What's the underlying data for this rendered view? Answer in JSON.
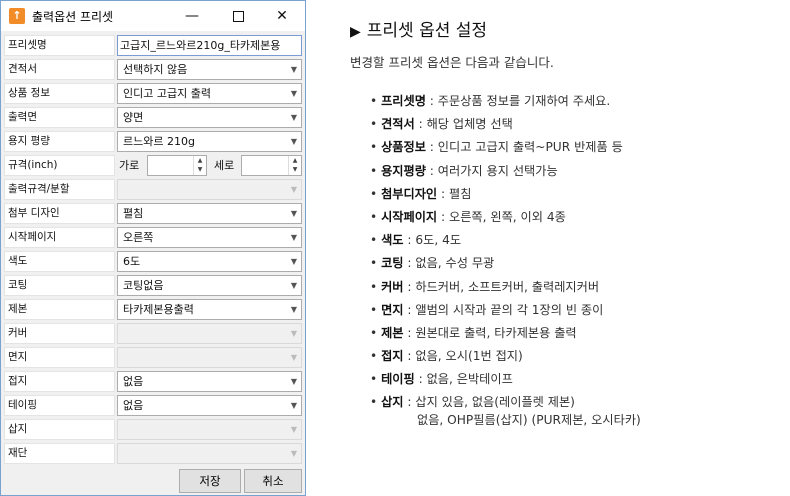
{
  "dialog": {
    "title": "출력옵션 프리셋",
    "rows": [
      {
        "label": "프리셋명",
        "value": "고급지_르느와르210g_타카제본용"
      },
      {
        "label": "견적서",
        "value": "선택하지 않음"
      },
      {
        "label": "상품 정보",
        "value": "인디고 고급지 출력"
      },
      {
        "label": "출력면",
        "value": "양면"
      },
      {
        "label": "용지 평량",
        "value": "르느와르 210g"
      },
      {
        "label": "규격(inch)",
        "width_label": "가로",
        "height_label": "세로"
      },
      {
        "label": "출력규격/분할",
        "value": ""
      },
      {
        "label": "첨부 디자인",
        "value": "펼침"
      },
      {
        "label": "시작페이지",
        "value": "오른쪽"
      },
      {
        "label": "색도",
        "value": "6도"
      },
      {
        "label": "코팅",
        "value": "코팅없음"
      },
      {
        "label": "제본",
        "value": "타카제본용출력"
      },
      {
        "label": "커버",
        "value": ""
      },
      {
        "label": "면지",
        "value": ""
      },
      {
        "label": "접지",
        "value": "없음"
      },
      {
        "label": "테이핑",
        "value": "없음"
      },
      {
        "label": "삽지",
        "value": ""
      },
      {
        "label": "재단",
        "value": ""
      }
    ],
    "save_label": "저장",
    "cancel_label": "취소"
  },
  "panel": {
    "title": "프리셋 옵션 설정",
    "description": "변경할 프리셋 옵션은 다음과 같습니다.",
    "items": [
      {
        "name": "프리셋명",
        "text": " : 주문상품 정보를 기재하여 주세요."
      },
      {
        "name": "견적서",
        "text": " : 해당 업체명 선택"
      },
      {
        "name": "상품정보",
        "text": " :  인디고 고급지 출력~PUR 반제품 등"
      },
      {
        "name": "용지평량",
        "text": " : 여러가지 용지 선택가능"
      },
      {
        "name": "첨부디자인",
        "text": " : 펼침"
      },
      {
        "name": "시작페이지",
        "text": " : 오른쪽, 왼쪽, 이외 4종"
      },
      {
        "name": "색도",
        "text": " : 6도, 4도"
      },
      {
        "name": "코팅",
        "text": " : 없음, 수성 무광"
      },
      {
        "name": "커버",
        "text": " : 하드커버, 소프트커버, 출력레지커버"
      },
      {
        "name": "면지",
        "text": " : 앨범의 시작과 끝의 각 1장의 빈 종이"
      },
      {
        "name": "제본",
        "text": " : 원본대로 출력, 타카제본용 출력"
      },
      {
        "name": "접지",
        "text": " : 없음, 오시(1번 접지)"
      },
      {
        "name": "테이핑",
        "text": " :  없음, 은박테이프"
      },
      {
        "name": "삽지",
        "text": " : 삽지 있음, 없음(레이플렛 제본)"
      }
    ],
    "continuation": "없음, OHP필름(삽지) (PUR제본, 오시타카)"
  }
}
